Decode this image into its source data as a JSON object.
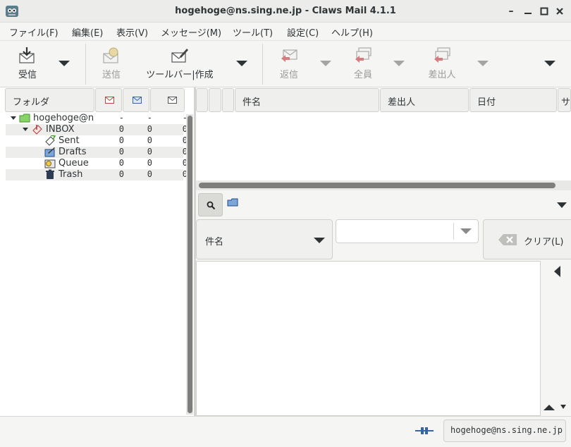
{
  "window": {
    "title": "hogehoge@ns.sing.ne.jp - Claws Mail 4.1.1"
  },
  "menu": [
    "ファイル(F)",
    "編集(E)",
    "表示(V)",
    "メッセージ(M)",
    "ツール(T)",
    "設定(C)",
    "ヘルプ(H)"
  ],
  "toolbar": {
    "receive": "受信",
    "send": "送信",
    "compose": "ツールバー|作成",
    "reply": "返信",
    "reply_all": "全員",
    "reply_sender": "差出人"
  },
  "folder_header": {
    "folder": "フォルダ"
  },
  "folders": [
    {
      "name": "hogehoge@ns",
      "unread": "-",
      "new": "-",
      "total": "-"
    },
    {
      "name": "INBOX",
      "unread": "0",
      "new": "0",
      "total": "0"
    },
    {
      "name": "Sent",
      "unread": "0",
      "new": "0",
      "total": "0"
    },
    {
      "name": "Drafts",
      "unread": "0",
      "new": "0",
      "total": "0"
    },
    {
      "name": "Queue",
      "unread": "0",
      "new": "0",
      "total": "0"
    },
    {
      "name": "Trash",
      "unread": "0",
      "new": "0",
      "total": "0"
    }
  ],
  "msg_headers": {
    "subject": "件名",
    "from": "差出人",
    "date": "日付",
    "extra": "サ"
  },
  "quicksearch": {
    "type": "件名",
    "value": "",
    "clear": "クリア(L)"
  },
  "status": {
    "account": "hogehoge@ns.sing.ne.jp"
  },
  "colors": {
    "folder_green": "#3f9a2a",
    "accent_blue": "#3465a4",
    "scrollbar": "#7e7f7d"
  }
}
